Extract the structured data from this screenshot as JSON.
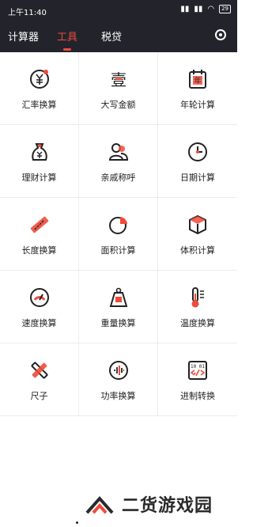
{
  "status_bar": {
    "time": "上午11:40",
    "battery": "29"
  },
  "nav": {
    "tabs": [
      {
        "label": "计算器",
        "active": false
      },
      {
        "label": "工具",
        "active": true
      },
      {
        "label": "税贷",
        "active": false
      }
    ]
  },
  "tools": [
    {
      "label": "汇率换算",
      "icon": "currency-exchange-icon"
    },
    {
      "label": "大写金额",
      "icon": "chinese-numeral-icon",
      "glyph": "壹"
    },
    {
      "label": "年轮计算",
      "icon": "calendar-year-icon",
      "glyph": "年"
    },
    {
      "label": "理财计算",
      "icon": "money-bag-icon"
    },
    {
      "label": "亲戚称呼",
      "icon": "relatives-icon"
    },
    {
      "label": "日期计算",
      "icon": "clock-icon"
    },
    {
      "label": "长度换算",
      "icon": "ruler-icon"
    },
    {
      "label": "面积计算",
      "icon": "area-pie-icon"
    },
    {
      "label": "体积计算",
      "icon": "cube-icon"
    },
    {
      "label": "速度换算",
      "icon": "speedometer-icon"
    },
    {
      "label": "重量换算",
      "icon": "weight-icon"
    },
    {
      "label": "温度换算",
      "icon": "thermometer-icon"
    },
    {
      "label": "尺子",
      "icon": "ruler-pencil-icon"
    },
    {
      "label": "功率换算",
      "icon": "power-wave-icon"
    },
    {
      "label": "进制转换",
      "icon": "binary-code-icon",
      "glyph": "10 01"
    }
  ],
  "watermark": {
    "text": "二货游戏园"
  },
  "colors": {
    "accent": "#f04a3a",
    "header_bg": "#23242b"
  }
}
